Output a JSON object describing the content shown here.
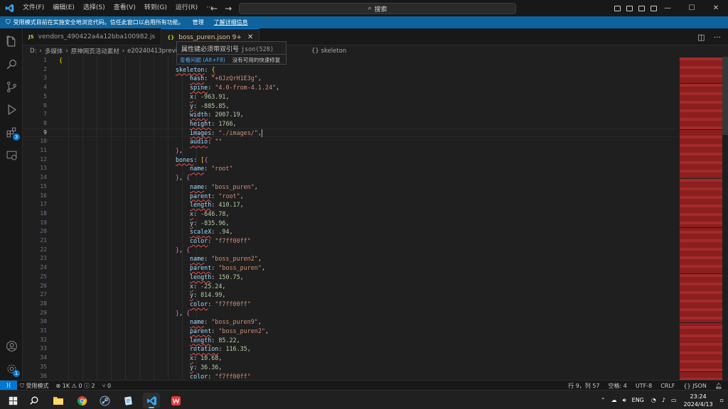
{
  "menu": [
    "文件(F)",
    "编辑(E)",
    "选择(S)",
    "查看(V)",
    "转到(G)",
    "运行(R)",
    "···"
  ],
  "search": {
    "label": "搜索"
  },
  "banner": {
    "text": "受限模式目前在实施安全地浏览代码。信任此窗口以启用所有功能。",
    "manage": "管理",
    "learn_more": "了解详细信息"
  },
  "tabs": [
    {
      "icon": "JS",
      "label": "vendors_490422a4a12bba100982.js"
    },
    {
      "icon": "{}",
      "label": "boss_puren.json 9+"
    }
  ],
  "breadcrumb": {
    "path": [
      "D:",
      "多媒体",
      "原神网页活动素材",
      "e20240413preview"
    ],
    "tail": "{} skeleton"
  },
  "hover": {
    "message": "属性键必须带双引号",
    "code": "json(528)",
    "action_view": "查看问题 (Alt+F8)",
    "action_fix": "没有可用的快速修复"
  },
  "code_lines": [
    {
      "n": "1",
      "t": "{"
    },
    {
      "n": "2",
      "t": "skeleton: {"
    },
    {
      "n": "3",
      "t": "hash: \"+6JzQrH1E3g\","
    },
    {
      "n": "4",
      "t": "spine: \"4.0-from-4.1.24\","
    },
    {
      "n": "5",
      "t": "x: -963.91,"
    },
    {
      "n": "6",
      "t": "y: -885.85,"
    },
    {
      "n": "7",
      "t": "width: 2007.19,"
    },
    {
      "n": "8",
      "t": "height: 1766,"
    },
    {
      "n": "9",
      "t": "images: \"./images/\","
    },
    {
      "n": "10",
      "t": "audio: \"\""
    },
    {
      "n": "11",
      "t": "},"
    },
    {
      "n": "12",
      "t": "bones: [{"
    },
    {
      "n": "13",
      "t": "name: \"root\""
    },
    {
      "n": "14",
      "t": "}, {"
    },
    {
      "n": "15",
      "t": "name: \"boss_puren\","
    },
    {
      "n": "16",
      "t": "parent: \"root\","
    },
    {
      "n": "17",
      "t": "length: 410.17,"
    },
    {
      "n": "18",
      "t": "x: -646.78,"
    },
    {
      "n": "19",
      "t": "y: -835.96,"
    },
    {
      "n": "20",
      "t": "scaleX: .94,"
    },
    {
      "n": "21",
      "t": "color: \"f7ff00ff\""
    },
    {
      "n": "22",
      "t": "}, {"
    },
    {
      "n": "23",
      "t": "name: \"boss_puren2\","
    },
    {
      "n": "24",
      "t": "parent: \"boss_puren\","
    },
    {
      "n": "25",
      "t": "length: 150.75,"
    },
    {
      "n": "26",
      "t": "x: -25.24,"
    },
    {
      "n": "27",
      "t": "y: 814.99,"
    },
    {
      "n": "28",
      "t": "color: \"f7ff00ff\""
    },
    {
      "n": "29",
      "t": "}, {"
    },
    {
      "n": "30",
      "t": "name: \"boss_puren9\","
    },
    {
      "n": "31",
      "t": "parent: \"boss_puren2\","
    },
    {
      "n": "32",
      "t": "length: 85.22,"
    },
    {
      "n": "33",
      "t": "rotation: 116.35,"
    },
    {
      "n": "34",
      "t": "x: 10.68,"
    },
    {
      "n": "35",
      "t": "y: 36.36,"
    },
    {
      "n": "36",
      "t": "color: \"f7ff00ff\""
    }
  ],
  "status": {
    "remote": "⟩⟨",
    "restricted": "受限模式",
    "problems": "⊗ 1K ⚠ 0 ⓘ 2",
    "ports": "⑂ 0",
    "position": "行 9，列 57",
    "spaces": "空格: 4",
    "encoding": "UTF-8",
    "eol": "CRLF",
    "language": "{} JSON"
  },
  "taskbar": {
    "lang": "ENG",
    "time": "23:24",
    "date": "2024/4/13"
  },
  "activity_badges": {
    "extensions": "3",
    "settings": "1"
  },
  "colors": {
    "accent": "#0078d4",
    "banner": "#0e639c",
    "error": "#f14c4c"
  }
}
